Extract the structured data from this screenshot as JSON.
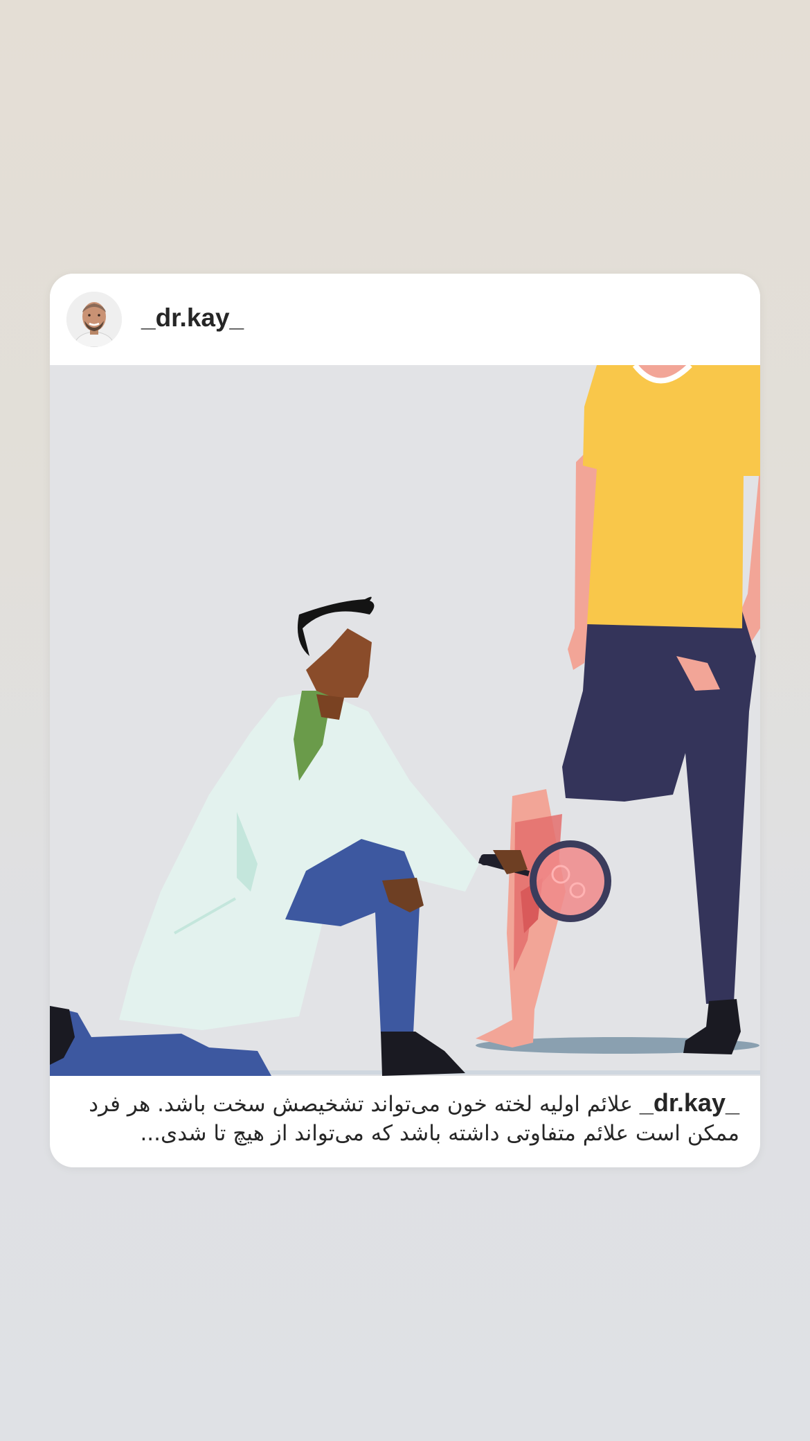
{
  "post": {
    "username": "_dr.kay_",
    "avatar_icon": "profile-photo",
    "image_icon": "doctor-examining-leg-illustration",
    "caption": {
      "username": "_dr.kay_",
      "text": "علائم اولیه لخته خون می‌تواند تشخیصش سخت باشد. هر فرد ممکن است علائم متفاوتی داشته باشد که می‌تواند از هیچ تا شدی..."
    }
  },
  "colors": {
    "background_top": "#e4ded5",
    "background_bottom": "#dfe1e5",
    "card": "#ffffff",
    "text": "#262626",
    "shirt": "#f9c74a",
    "pants": "#34345a",
    "coat": "#e3f2ee",
    "doctor_pants": "#3d58a0"
  }
}
